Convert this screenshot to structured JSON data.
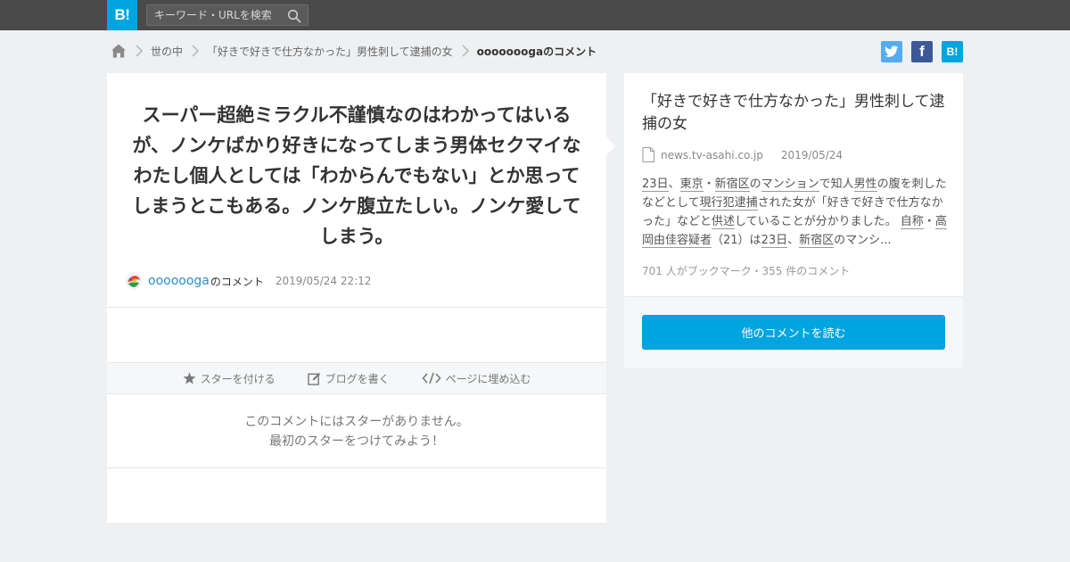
{
  "header": {
    "logo_text": "B!",
    "search_placeholder": "キーワード・URLを検索",
    "search_icon": "search-icon"
  },
  "breadcrumb": {
    "home_icon": "home-icon",
    "items": [
      "世の中",
      "「好きで好きで仕方なかった」男性刺して逮捕の女",
      "ooooooogaのコメント"
    ]
  },
  "share": {
    "twitter_label": "Twitter",
    "facebook_label": "f",
    "hatena_label": "B!"
  },
  "comment": {
    "text": "スーパー超絶ミラクル不謹慎なのはわかってはいるが、ノンケばかり好きになってしまう男体セクマイなわたし個人としては「わからんでもない」とか思ってしまうとこもある。ノンケ腹立たしい。ノンケ愛してしまう。",
    "author": "ooooooga",
    "author_suffix": "のコメント",
    "date": "2019/05/24 22:12"
  },
  "actions": {
    "star": "スターを付ける",
    "blog": "ブログを書く",
    "embed": "ページに埋め込む"
  },
  "stars": {
    "line1": "このコメントにはスターがありません。",
    "line2": "最初のスターをつけてみよう！"
  },
  "entry": {
    "title": "「好きで好きで仕方なかった」男性刺して逮捕の女",
    "domain": "news.tv-asahi.co.jp",
    "date": "2019/05/24",
    "summary_parts": [
      {
        "t": "23日",
        "u": true
      },
      {
        "t": "、",
        "u": false
      },
      {
        "t": "東京",
        "u": true
      },
      {
        "t": "・",
        "u": false
      },
      {
        "t": "新宿区",
        "u": true
      },
      {
        "t": "の",
        "u": false
      },
      {
        "t": "マンション",
        "u": true
      },
      {
        "t": "で知人",
        "u": false
      },
      {
        "t": "男性",
        "u": true
      },
      {
        "t": "の腹を刺したなどとして",
        "u": false
      },
      {
        "t": "現行犯逮捕",
        "u": true
      },
      {
        "t": "された女が「好きで好きで仕方なかった」などと",
        "u": false
      },
      {
        "t": "供述",
        "u": true
      },
      {
        "t": "していることが分かりました。 ",
        "u": false
      },
      {
        "t": "自称",
        "u": true
      },
      {
        "t": "・",
        "u": false
      },
      {
        "t": "高岡由佳容疑者",
        "u": true
      },
      {
        "t": "（21）は",
        "u": false
      },
      {
        "t": "23日",
        "u": true
      },
      {
        "t": "、",
        "u": false
      },
      {
        "t": "新宿区",
        "u": true
      },
      {
        "t": "のマンシ...",
        "u": false
      }
    ],
    "count": "701 人がブックマーク・355 件のコメント",
    "read_button": "他のコメントを読む"
  },
  "colors": {
    "brand": "#00a4de",
    "topbar": "#4a4a4a",
    "link": "#2a8fc9"
  }
}
